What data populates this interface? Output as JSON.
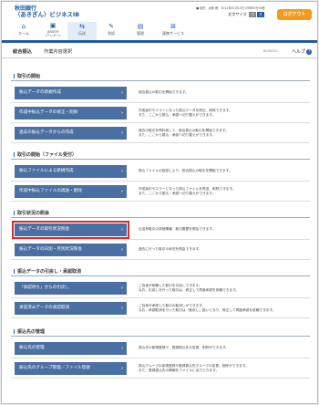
{
  "header": {
    "bank_name": "秋田銀行",
    "service_name": "〈あきぎん〉ビジネスIB",
    "user_info": "■ 秋田　太郎 様　2012年01月13日 09時30分00秒",
    "text_size_label": "文字サイズ",
    "text_size_small": "小",
    "text_size_large": "大",
    "logout_label": "ログアウト",
    "nav": [
      {
        "label": "ホーム",
        "icon": "house-icon"
      },
      {
        "label": "ANSER\n(アンサー)",
        "icon": "anser-icon"
      },
      {
        "label": "伝送",
        "icon": "transfer-icon"
      },
      {
        "label": "承認",
        "icon": "approve-icon"
      },
      {
        "label": "管理",
        "icon": "manage-icon"
      },
      {
        "label": "連携サービス",
        "icon": "link-icon"
      }
    ]
  },
  "breadcrumb": {
    "category": "総合振込",
    "page": "作業内容選択",
    "screen_id": "BSSK001",
    "help": "ヘルプ"
  },
  "sections": [
    {
      "title": "取引の開始",
      "rows": [
        {
          "button": "振込データの新規作成",
          "desc": [
            "総合振込の取引を開始できます。"
          ]
        },
        {
          "button": "作成中振込データの修正・削除",
          "desc": [
            "作成途中やエラーとなった振込データを修正、削除できます。",
            "また、ここから振込・承認へ切り替えができます。"
          ]
        },
        {
          "button": "過去の振込データからの作成",
          "desc": [
            "過去の取引を再利用して、総合振込の取引を開始できます。",
            "また、ここから振込・承認へ切り替えができます。"
          ]
        }
      ]
    },
    {
      "title": "取引の開始（ファイル受付）",
      "rows": [
        {
          "button": "振込ファイルによる新規作成",
          "desc": [
            "振込ファイルの指定により、総合振込の取引を開始できます。"
          ]
        },
        {
          "button": "作成中振込ファイルの再送・削除",
          "desc": [
            "作成途中やエラーとなった振込ファイルを再送、削除できます。",
            "また、ここから振込・承認へ切り替えができます。"
          ]
        }
      ]
    },
    {
      "title": "取引状況の照会",
      "rows": [
        {
          "button": "振込データの取引状況照会",
          "desc": [
            "伝送系取引の詳細情報、取引履歴を照会できます。"
          ]
        },
        {
          "button": "振込データの日別・月別状況照会",
          "desc": [
            "過去に行った取引の状況を照会できます。"
          ]
        }
      ]
    },
    {
      "title": "振込データの引戻し・承認取消",
      "rows": [
        {
          "button": "「承認待ち」からの引戻し",
          "desc": [
            "ご自身が依頼した取引を引戻しできます。",
            "なお、引戻しを行った取引は、修正して再度承認を依頼できます。"
          ]
        },
        {
          "button": "承認済みデータの承認取消",
          "desc": [
            "ご自身が承認した取引の取消しができます。",
            "なお、承認取消を行った取引は「差戻し」扱いとなり、修正して再度承認を依頼できます。"
          ]
        }
      ]
    },
    {
      "title": "振込先の管理",
      "rows": [
        {
          "button": "振込先の管理",
          "desc": [
            "振込先の新規登録や、登録振込先の変更、削除ができます。"
          ]
        },
        {
          "button": "振込先のグループ管理／ファイル登録",
          "desc": [
            "振込グループの新規登録や登録振込先グループの変更、削除ができます。",
            "また、登録振込先の情報をファイルに出力できます。"
          ]
        }
      ]
    }
  ],
  "colors": {
    "brand": "#1f5aa6",
    "button": "#4a6fa3",
    "logout": "#f39b1a",
    "highlight": "#d12f2f"
  }
}
